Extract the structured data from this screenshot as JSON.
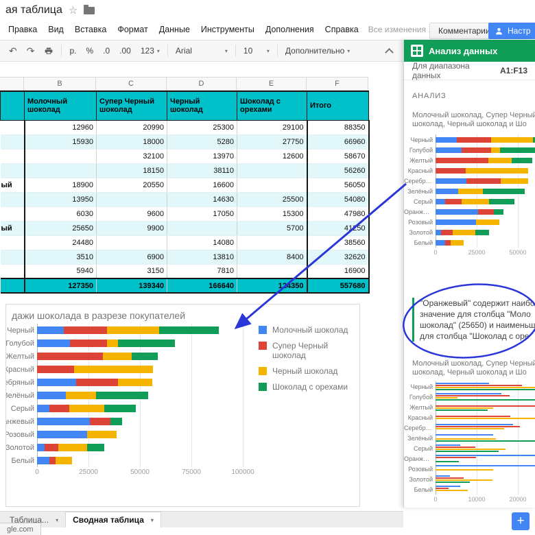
{
  "titlebar": {
    "title_fragment": "ая таблица"
  },
  "icons": {
    "star": "☆",
    "caret": "▾",
    "undo": "↶",
    "redo": "↷",
    "plus": "+"
  },
  "menubar": {
    "items": [
      "Правка",
      "Вид",
      "Вставка",
      "Формат",
      "Данные",
      "Инструменты",
      "Дополнения",
      "Справка"
    ],
    "autosave": "Все изменения ...",
    "comments": "Комментарии",
    "share": "Настр"
  },
  "toolbar": {
    "currency": "р.",
    "percent": "%",
    "dec0": ".0",
    "dec00": ".00",
    "fmt": "123",
    "font": "Arial",
    "size": "10",
    "more": "Дополнительно"
  },
  "grid": {
    "col_letters": [
      "B",
      "C",
      "D",
      "E",
      "F"
    ]
  },
  "pivot": {
    "headers": [
      "Молочный шоколад",
      "Супер Черный шоколад",
      "Черный шоколад",
      "Шоколад с орехами",
      "Итого"
    ],
    "rows": [
      {
        "label_fragment": "",
        "cells": [
          "12960",
          "20990",
          "25300",
          "29100",
          "88350"
        ]
      },
      {
        "label_fragment": "",
        "cells": [
          "15930",
          "18000",
          "5280",
          "27750",
          "66960"
        ]
      },
      {
        "label_fragment": "",
        "cells": [
          "",
          "32100",
          "13970",
          "12600",
          "58670"
        ]
      },
      {
        "label_fragment": "",
        "cells": [
          "",
          "18150",
          "38110",
          "",
          "56260"
        ]
      },
      {
        "label_fragment": "ый",
        "cells": [
          "18900",
          "20550",
          "16600",
          "",
          "56050"
        ]
      },
      {
        "label_fragment": "",
        "cells": [
          "13950",
          "",
          "14630",
          "25500",
          "54080"
        ]
      },
      {
        "label_fragment": "",
        "cells": [
          "6030",
          "9600",
          "17050",
          "15300",
          "47980"
        ]
      },
      {
        "label_fragment": "ый",
        "cells": [
          "25650",
          "9900",
          "",
          "5700",
          "41250"
        ]
      },
      {
        "label_fragment": "",
        "cells": [
          "24480",
          "",
          "14080",
          "",
          "38560"
        ]
      },
      {
        "label_fragment": "",
        "cells": [
          "3510",
          "6900",
          "13810",
          "8400",
          "32620"
        ]
      },
      {
        "label_fragment": "",
        "cells": [
          "5940",
          "3150",
          "7810",
          "",
          "16900"
        ]
      }
    ],
    "totals": [
      "127350",
      "139340",
      "166640",
      "124350",
      "557680"
    ]
  },
  "chart_data": [
    {
      "id": "main",
      "type": "bar",
      "subtype": "stacked-horizontal",
      "title": "дажи шоколада в разрезе покупателей",
      "categories": [
        "Черный",
        "Голубой",
        "Желтый",
        "Красный",
        "Серебряный",
        "Зелёный",
        "Серый",
        "Оранжевый",
        "Розовый",
        "Золотой",
        "Белый"
      ],
      "series": [
        {
          "name": "Молочный шоколад",
          "color": "#4285f4",
          "values": [
            12960,
            15930,
            0,
            0,
            18900,
            13950,
            6030,
            25650,
            24480,
            3510,
            5940
          ]
        },
        {
          "name": "Супер Черный шоколад",
          "color": "#db4437",
          "values": [
            20990,
            18000,
            32100,
            18150,
            20550,
            0,
            9600,
            9900,
            0,
            6900,
            3150
          ]
        },
        {
          "name": "Черный шоколад",
          "color": "#f4b400",
          "values": [
            25300,
            5280,
            13970,
            38110,
            16600,
            14630,
            17050,
            0,
            14080,
            13810,
            7810
          ]
        },
        {
          "name": "Шоколад с орехами",
          "color": "#0f9d58",
          "values": [
            29100,
            27750,
            12600,
            0,
            0,
            25500,
            15300,
            5700,
            0,
            8400,
            0
          ]
        }
      ],
      "x_ticks": [
        0,
        25000,
        50000,
        75000,
        100000
      ],
      "xlim": [
        0,
        100000
      ],
      "legend_position": "right",
      "grid": true
    },
    {
      "id": "panel1",
      "type": "bar",
      "subtype": "stacked-horizontal",
      "title_lines": [
        "Молочный шоколад, Супер Черный",
        "шоколад, Черный шоколад и Шо"
      ],
      "categories": [
        "Черный",
        "Голубой",
        "Желтый",
        "Красный",
        "Серебряный",
        "Зелёный",
        "Серый",
        "Оранжевый",
        "Розовый",
        "Золотой",
        "Белый"
      ],
      "series": [
        {
          "name": "Молочный шоколад",
          "color": "#4285f4",
          "values": [
            12960,
            15930,
            0,
            0,
            18900,
            13950,
            6030,
            25650,
            24480,
            3510,
            5940
          ]
        },
        {
          "name": "Супер Черный шоколад",
          "color": "#db4437",
          "values": [
            20990,
            18000,
            32100,
            18150,
            20550,
            0,
            9600,
            9900,
            0,
            6900,
            3150
          ]
        },
        {
          "name": "Черный шоколад",
          "color": "#f4b400",
          "values": [
            25300,
            5280,
            13970,
            38110,
            16600,
            14630,
            17050,
            0,
            14080,
            13810,
            7810
          ]
        },
        {
          "name": "Шоколад с орехами",
          "color": "#0f9d58",
          "values": [
            29100,
            27750,
            12600,
            0,
            0,
            25500,
            15300,
            5700,
            0,
            8400,
            0
          ]
        }
      ],
      "x_ticks": [
        0,
        25000,
        50000
      ],
      "grid": true
    },
    {
      "id": "panel2",
      "type": "bar",
      "subtype": "grouped-horizontal",
      "title_lines": [
        "Молочный шоколад, Супер Черный",
        "шоколад, Черный шоколад и Шо"
      ],
      "categories": [
        "Черный",
        "Голубой",
        "Желтый",
        "Красный",
        "Серебряный",
        "Зелёный",
        "Серый",
        "Оранжевый",
        "Розовый",
        "Золотой",
        "Белый"
      ],
      "series": [
        {
          "name": "Молочный шоколад",
          "color": "#4285f4",
          "values": [
            12960,
            15930,
            0,
            0,
            18900,
            13950,
            6030,
            25650,
            24480,
            3510,
            5940
          ]
        },
        {
          "name": "Супер Черный шоколад",
          "color": "#db4437",
          "values": [
            20990,
            18000,
            32100,
            18150,
            20550,
            0,
            9600,
            9900,
            0,
            6900,
            3150
          ]
        },
        {
          "name": "Черный шоколад",
          "color": "#f4b400",
          "values": [
            25300,
            5280,
            13970,
            38110,
            16600,
            14630,
            17050,
            0,
            14080,
            13810,
            7810
          ]
        },
        {
          "name": "Шоколад с орехами",
          "color": "#0f9d58",
          "values": [
            29100,
            27750,
            12600,
            0,
            0,
            25500,
            15300,
            5700,
            0,
            8400,
            0
          ]
        }
      ],
      "x_ticks": [
        0,
        10000,
        20000
      ],
      "grid": true
    }
  ],
  "panel": {
    "header_title": "Анализ данных",
    "range_label": "Для диапазона данных",
    "range_ref": "A1:F13",
    "section_label": "АНАЛИЗ",
    "insight_lines": [
      "\"Оранжевый\" содержит наибо",
      "значение для столбца \"Моло",
      "шоколад\" (25650) и наименьш",
      "для столбца \"Шоколад с оре"
    ]
  },
  "tabs": {
    "items": [
      {
        "label": "Таблица...",
        "active": false
      },
      {
        "label": "Сводная таблица",
        "active": true
      }
    ]
  },
  "status": {
    "url_fragment": "gle.com"
  },
  "colors": {
    "teal": "#00c0ca",
    "band": "#e2f7f9",
    "green": "#0f9d58",
    "blue": "#4285f4",
    "annotation": "#2b36d9"
  }
}
